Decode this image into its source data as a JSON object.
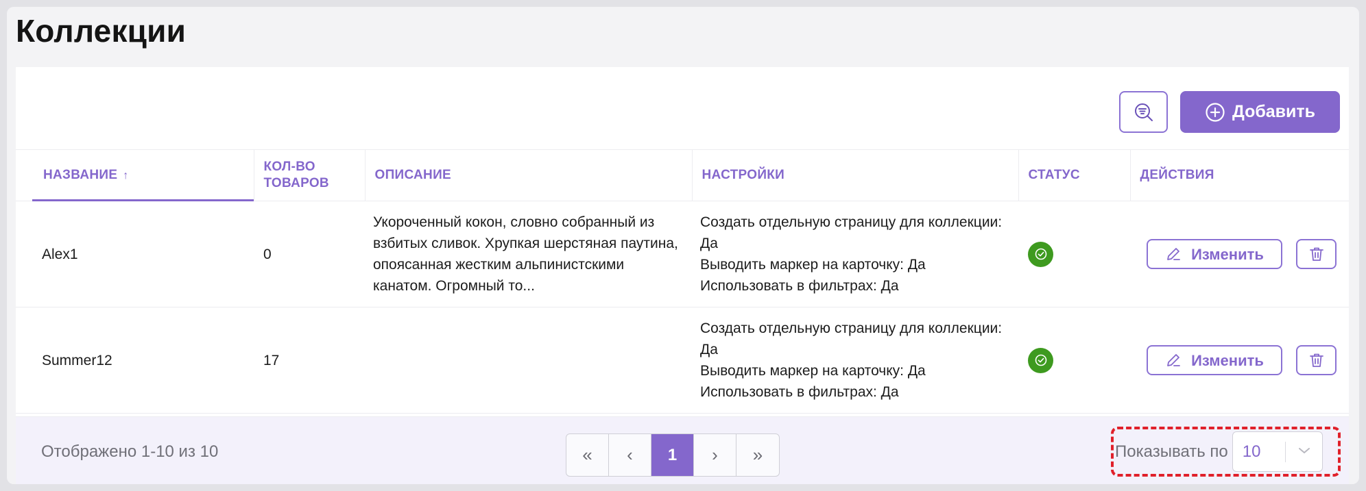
{
  "page": {
    "title": "Коллекции"
  },
  "toolbar": {
    "add_label": "Добавить",
    "filter_icon": "search-filter-icon",
    "add_icon": "plus-circle-icon"
  },
  "table": {
    "columns": {
      "name": "НАЗВАНИЕ",
      "name_sort": "↑",
      "count": "КОЛ-ВО ТОВАРОВ",
      "description": "ОПИСАНИЕ",
      "settings": "НАСТРОЙКИ",
      "status": "СТАТУС",
      "actions": "ДЕЙСТВИЯ"
    },
    "rows": [
      {
        "name": "Alex1",
        "count": "0",
        "description": "Укороченный кокон, словно собранный из взбитых сливок. Хрупкая шерстяная паутина, опоясанная жестким альпинистскими канатом. Огромный то...",
        "settings": [
          "Создать отдельную страницу для коллекции: Да",
          "Выводить маркер на карточку: Да",
          "Использовать в фильтрах: Да"
        ],
        "status": "active",
        "edit_label": "Изменить"
      },
      {
        "name": "Summer12",
        "count": "17",
        "description": "",
        "settings": [
          "Создать отдельную страницу для коллекции: Да",
          "Выводить маркер на карточку: Да",
          "Использовать в фильтрах: Да"
        ],
        "status": "active",
        "edit_label": "Изменить"
      }
    ]
  },
  "footer": {
    "info": "Отображено 1-10 из 10",
    "pagination": {
      "first": "«",
      "prev": "‹",
      "current": "1",
      "next": "›",
      "last": "»"
    },
    "per_page_label": "Показывать по",
    "per_page_value": "10"
  },
  "colors": {
    "accent": "#8467cc",
    "status_active": "#3e9a1f",
    "highlight": "#e0202a"
  }
}
